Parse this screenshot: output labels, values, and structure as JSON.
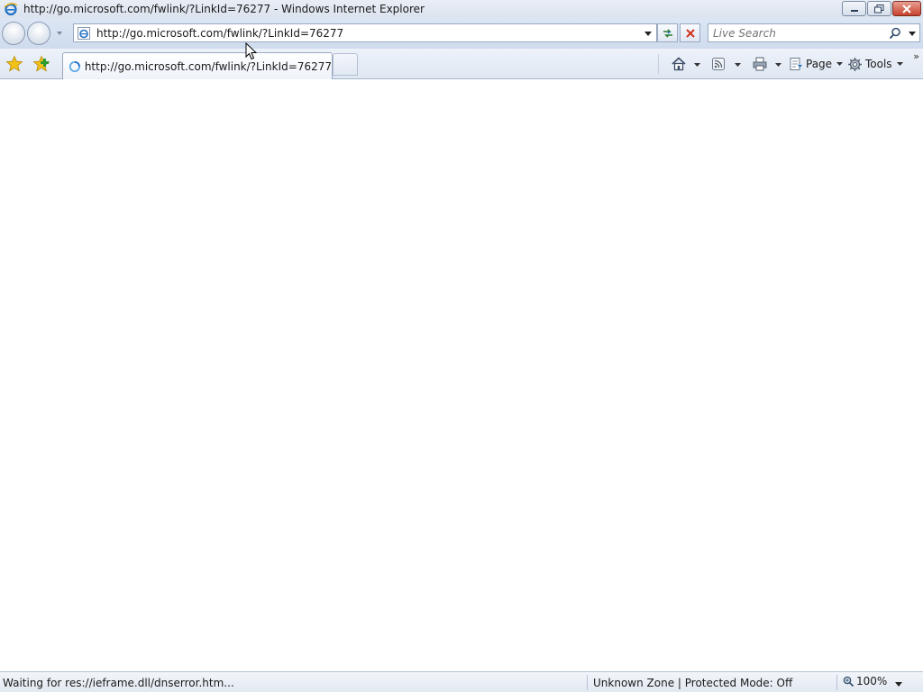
{
  "window": {
    "title": "http://go.microsoft.com/fwlink/?LinkId=76277 - Windows Internet Explorer"
  },
  "navigation": {
    "address_url": "http://go.microsoft.com/fwlink/?LinkId=76277",
    "search_placeholder": "Live Search"
  },
  "tabs": [
    {
      "title": "http://go.microsoft.com/fwlink/?LinkId=76277",
      "loading": true
    }
  ],
  "command_bar": {
    "page_label": "Page",
    "tools_label": "Tools",
    "more_label": "»"
  },
  "status_bar": {
    "status_text": "Waiting for res://ieframe.dll/dnserror.htm...",
    "zone_text": "Unknown Zone | Protected Mode: Off",
    "zoom_text": "100%"
  },
  "colors": {
    "titlebar": "#dbe3ee",
    "navbar": "#cfdcee",
    "close_button": "#c7402b",
    "ie_blue": "#1e6fc5",
    "star_yellow": "#f2c21a"
  }
}
